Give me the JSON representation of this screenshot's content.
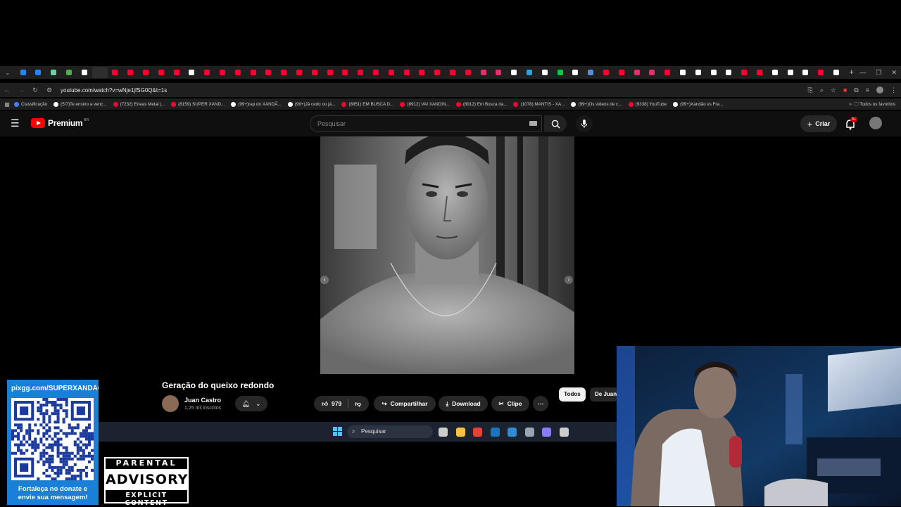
{
  "browser": {
    "url": "youtube.com/watch?v=wNje1jfSG0Q&t=1s",
    "tab_colors": [
      "#1f88ff",
      "#1f88ff",
      "#6ad4a0",
      "#4caf50",
      "#ffffff",
      "#2e2e2e",
      "#ff0033",
      "#ff0033",
      "#ff0033",
      "#ff0033",
      "#ff0033",
      "#ffffff",
      "#ff0033",
      "#ff0033",
      "#ff0033",
      "#ff0033",
      "#ff0033",
      "#ff0033",
      "#ff0033",
      "#ff0033",
      "#ff0033",
      "#ff0033",
      "#ff0033",
      "#ff0033",
      "#ff0033",
      "#ff0033",
      "#ff0033",
      "#ff0033",
      "#ff0033",
      "#ff0033",
      "#e1306c",
      "#e1306c",
      "#ffffff",
      "#2aa3e0",
      "#ffffff",
      "#00cc44",
      "#ffffff",
      "#5a8fd6",
      "#ff0033",
      "#ff0033",
      "#e1306c",
      "#e1306c",
      "#ff0033",
      "#ffffff",
      "#ffffff",
      "#ffffff",
      "#ffffff",
      "#ff0033",
      "#ff0033",
      "#ffffff",
      "#ffffff",
      "#ffffff",
      "#ff0033",
      "#ffffff"
    ],
    "bookmarks": [
      {
        "label": "Classificação",
        "color": "#4a7bff"
      },
      {
        "label": "(5/7)Te ensino a venc...",
        "color": "#ffffff"
      },
      {
        "label": "(7232) Eneas Metal |...",
        "color": "#ff0033"
      },
      {
        "label": "(8159) SUPER XAND...",
        "color": "#ff0033"
      },
      {
        "label": "(99+)rap do XANDÃ...",
        "color": "#ffffff"
      },
      {
        "label": "(99+)Já cedo ou já...",
        "color": "#ffffff"
      },
      {
        "label": "(8851) EM BUSCA D...",
        "color": "#ff0033"
      },
      {
        "label": "(8912) VAI XANDIN...",
        "color": "#ff0033"
      },
      {
        "label": "(8912) Em Busca da...",
        "color": "#ff0033"
      },
      {
        "label": "(1078) MANTIS - XA...",
        "color": "#ff0033"
      },
      {
        "label": "(99+)Os vídeos de c...",
        "color": "#ffffff"
      },
      {
        "label": "(9338) YouTube",
        "color": "#ff0033"
      },
      {
        "label": "(99+)Xandão vs Fra...",
        "color": "#ffffff"
      }
    ],
    "all_bookmarks": "Todos os favoritos"
  },
  "youtube": {
    "logo_text": "Premium",
    "region": "BR",
    "search_placeholder": "Pesquisar",
    "create_label": "Criar",
    "notifications_badge": "9+",
    "video_title": "Geração do queixo redondo",
    "channel_name": "Juan Castro",
    "channel_subs": "1,25 mil inscritos",
    "likes": "979",
    "share_label": "Compartilhar",
    "download_label": "Download",
    "clip_label": "Clipe",
    "chips": [
      "Todos",
      "De Juan"
    ]
  },
  "taskbar": {
    "search_placeholder": "Pesquisar",
    "apps": [
      {
        "name": "task-view-icon",
        "color": "#cccccc"
      },
      {
        "name": "file-explorer-icon",
        "color": "#f5c242"
      },
      {
        "name": "chrome-icon",
        "color": "#e94235"
      },
      {
        "name": "steam-icon",
        "color": "#1b75bb"
      },
      {
        "name": "photos-icon",
        "color": "#2e8bd6"
      },
      {
        "name": "settings-icon",
        "color": "#9aa4b2"
      },
      {
        "name": "app-icon",
        "color": "#8a7cff"
      },
      {
        "name": "obs-icon",
        "color": "#cccccc"
      }
    ]
  },
  "overlay": {
    "donate_url": "pixgg.com/SUPERXANDÃO",
    "donate_message_1": "Fortaleça no donate e",
    "donate_message_2": "envie sua mensagem!",
    "advisory_top": "PARENTAL",
    "advisory_mid": "ADVISORY",
    "advisory_bottom": "EXPLICIT CONTENT"
  }
}
